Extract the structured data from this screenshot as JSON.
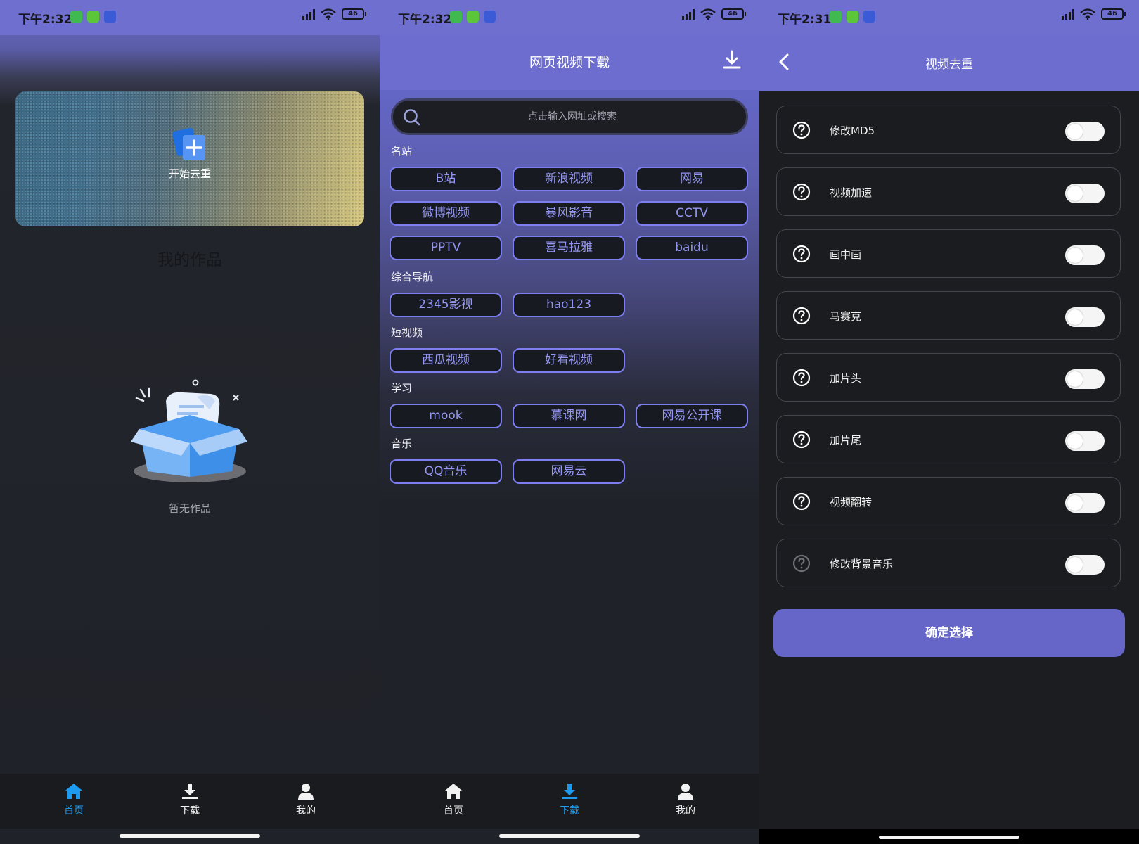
{
  "screens": [
    {
      "status": {
        "time": "下午2:32",
        "battery": "46"
      },
      "banner": {
        "button_label": "开始去重"
      },
      "section_title": "我的作品",
      "empty_text": "暂无作品",
      "nav": [
        {
          "label": "首页",
          "icon": "home-icon",
          "active": true
        },
        {
          "label": "下载",
          "icon": "download-icon",
          "active": false
        },
        {
          "label": "我的",
          "icon": "user-icon",
          "active": false
        }
      ]
    },
    {
      "status": {
        "time": "下午2:32",
        "battery": "46"
      },
      "header": {
        "title": "网页视频下载",
        "right_icon": "download-icon"
      },
      "search": {
        "placeholder": "点击输入网址或搜索"
      },
      "sections": [
        {
          "title": "名站",
          "items": [
            "B站",
            "新浪视频",
            "网易",
            "微博视频",
            "暴风影音",
            "CCTV",
            "PPTV",
            "喜马拉雅",
            "baidu"
          ]
        },
        {
          "title": "综合导航",
          "items": [
            "2345影视",
            "hao123"
          ]
        },
        {
          "title": "短视频",
          "items": [
            "西瓜视频",
            "好看视频"
          ]
        },
        {
          "title": "学习",
          "items": [
            "mook",
            "慕课网",
            "网易公开课"
          ]
        },
        {
          "title": "音乐",
          "items": [
            "QQ音乐",
            "网易云"
          ]
        }
      ],
      "nav": [
        {
          "label": "首页",
          "icon": "home-icon",
          "active": false
        },
        {
          "label": "下载",
          "icon": "download-icon",
          "active": true
        },
        {
          "label": "我的",
          "icon": "user-icon",
          "active": false
        }
      ]
    },
    {
      "status": {
        "time": "下午2:31",
        "battery": "46"
      },
      "header": {
        "title": "视频去重",
        "left_icon": "back-chevron-icon"
      },
      "options": [
        {
          "label": "修改MD5",
          "on": false
        },
        {
          "label": "视频加速",
          "on": false
        },
        {
          "label": "画中画",
          "on": false
        },
        {
          "label": "马赛克",
          "on": false
        },
        {
          "label": "加片头",
          "on": false
        },
        {
          "label": "加片尾",
          "on": false
        },
        {
          "label": "视频翻转",
          "on": false
        },
        {
          "label": "修改背景音乐",
          "on": false
        }
      ],
      "confirm_label": "确定选择"
    }
  ],
  "colors": {
    "header_purple": "#6c6dce",
    "chip_border": "#7d7ff0",
    "chip_text": "#9496f3",
    "nav_active": "#1d9bf0",
    "confirm_bg": "#6566c7"
  }
}
